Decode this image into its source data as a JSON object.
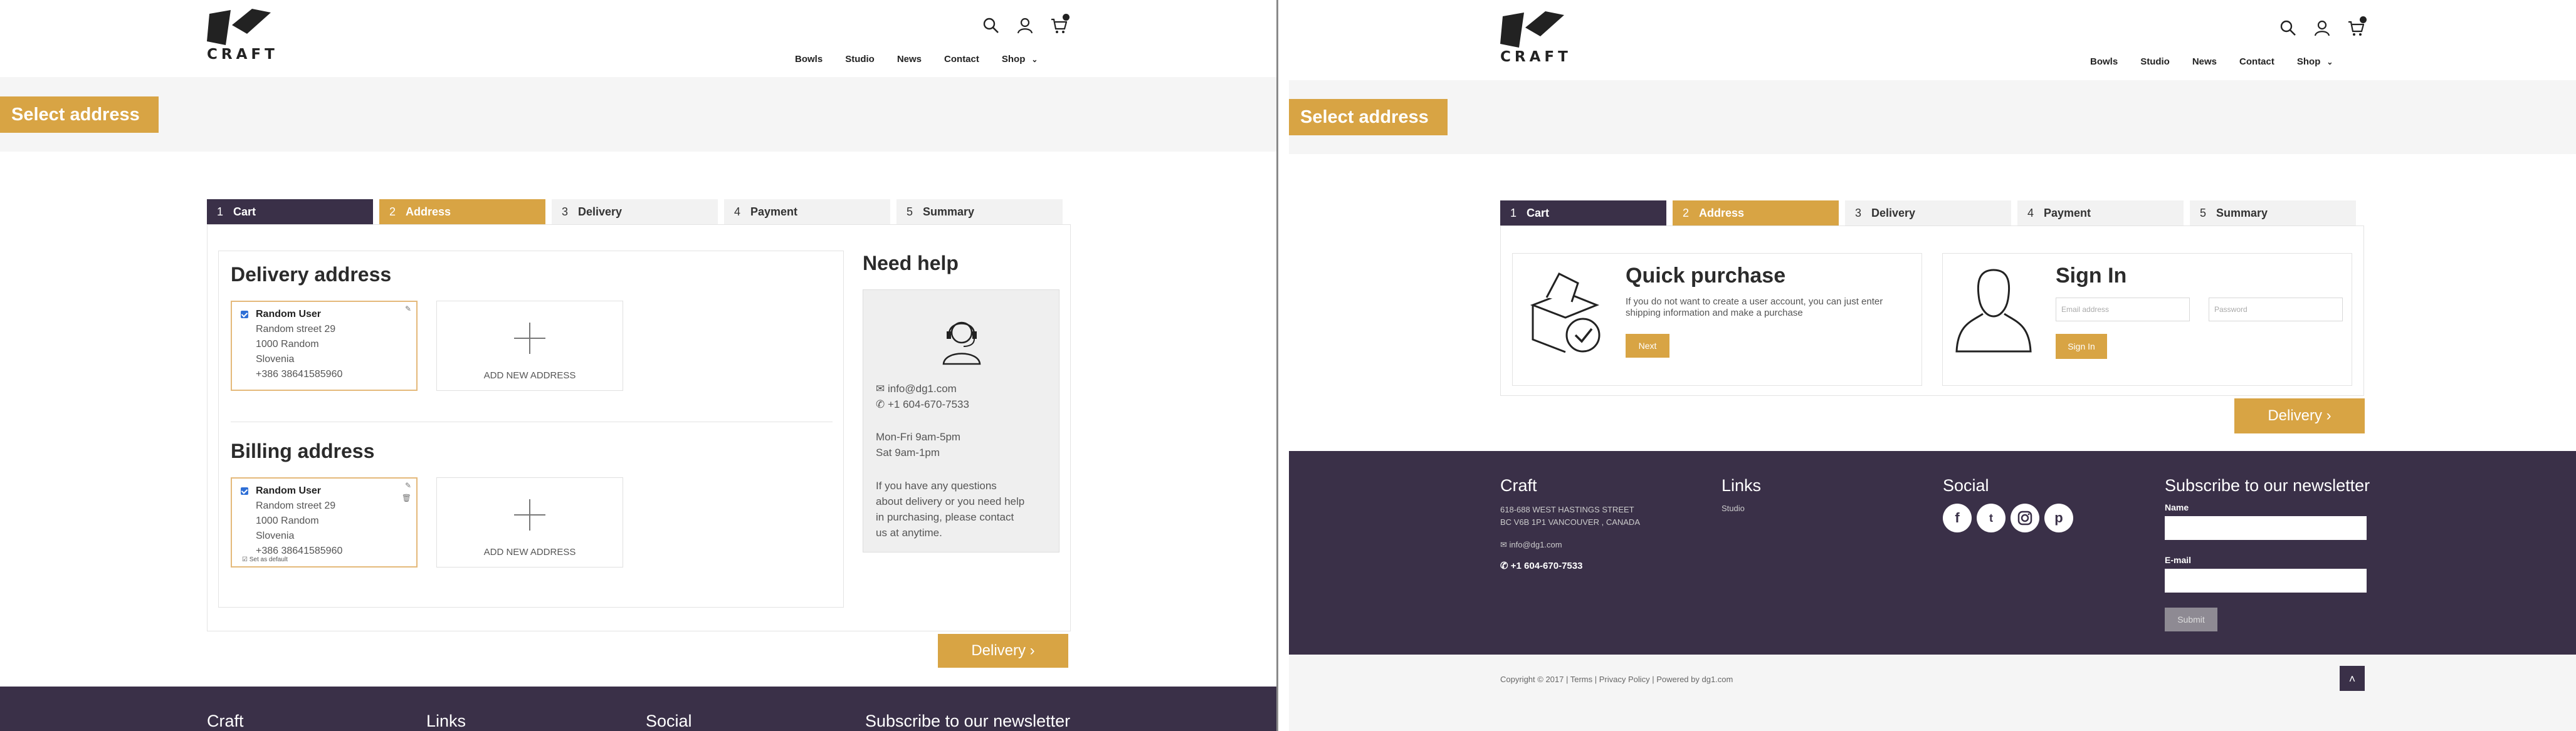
{
  "brand": {
    "name": "CRAFT"
  },
  "header": {
    "nav": [
      "Bowls",
      "Studio",
      "News",
      "Contact",
      "Shop"
    ],
    "icons": [
      "search-icon",
      "user-icon",
      "cart-icon"
    ]
  },
  "page_title": "Select address",
  "steps": [
    {
      "num": "1",
      "label": "Cart"
    },
    {
      "num": "2",
      "label": "Address"
    },
    {
      "num": "3",
      "label": "Delivery"
    },
    {
      "num": "4",
      "label": "Payment"
    },
    {
      "num": "5",
      "label": "Summary"
    }
  ],
  "delivery": {
    "title": "Delivery address",
    "address": [
      "Random User",
      "Random street 29",
      "1000 Random",
      "Slovenia",
      "+386 38641585960"
    ],
    "add_new": "ADD NEW ADDRESS"
  },
  "billing": {
    "title": "Billing address",
    "address": [
      "Random User",
      "Random street 29",
      "1000 Random",
      "Slovenia",
      "+386 38641585960"
    ],
    "set_default": "Set as default",
    "add_new": "ADD NEW ADDRESS"
  },
  "help": {
    "title": "Need help",
    "email": "info@dg1.com",
    "phone": "+1 604-670-7533",
    "hours1": "Mon-Fri 9am-5pm",
    "hours2": "Sat 9am-1pm",
    "text": "If you have any questions about delivery or you need help in purchasing, please contact us at anytime."
  },
  "delivery_button": "Delivery",
  "quick": {
    "title": "Quick purchase",
    "text": "If you do not want to create a user account, you can just enter shipping information and make a purchase",
    "button": "Next"
  },
  "signin": {
    "title": "Sign In",
    "email_placeholder": "Email address",
    "password_placeholder": "Password",
    "button": "Sign In"
  },
  "footer": {
    "craft_title": "Craft",
    "address1": "618-688 WEST HASTINGS STREET",
    "address2": "BC V6B 1P1 VANCOUVER , CANADA",
    "email": "info@dg1.com",
    "phone": "+1 604-670-7533",
    "links_title": "Links",
    "links": [
      "Studio"
    ],
    "social_title": "Social",
    "social": [
      "facebook-icon",
      "twitter-icon",
      "instagram-icon",
      "pinterest-icon"
    ],
    "newsletter_title": "Subscribe to our newsletter",
    "name_label": "Name",
    "email_label": "E-mail",
    "submit": "Submit",
    "copyright": "Copyright © 2017 | Terms | Privacy Policy | Powered by dg1.com"
  },
  "colors": {
    "accent": "#d8a444",
    "dark": "#3a3048",
    "band": "#f5f5f5"
  }
}
